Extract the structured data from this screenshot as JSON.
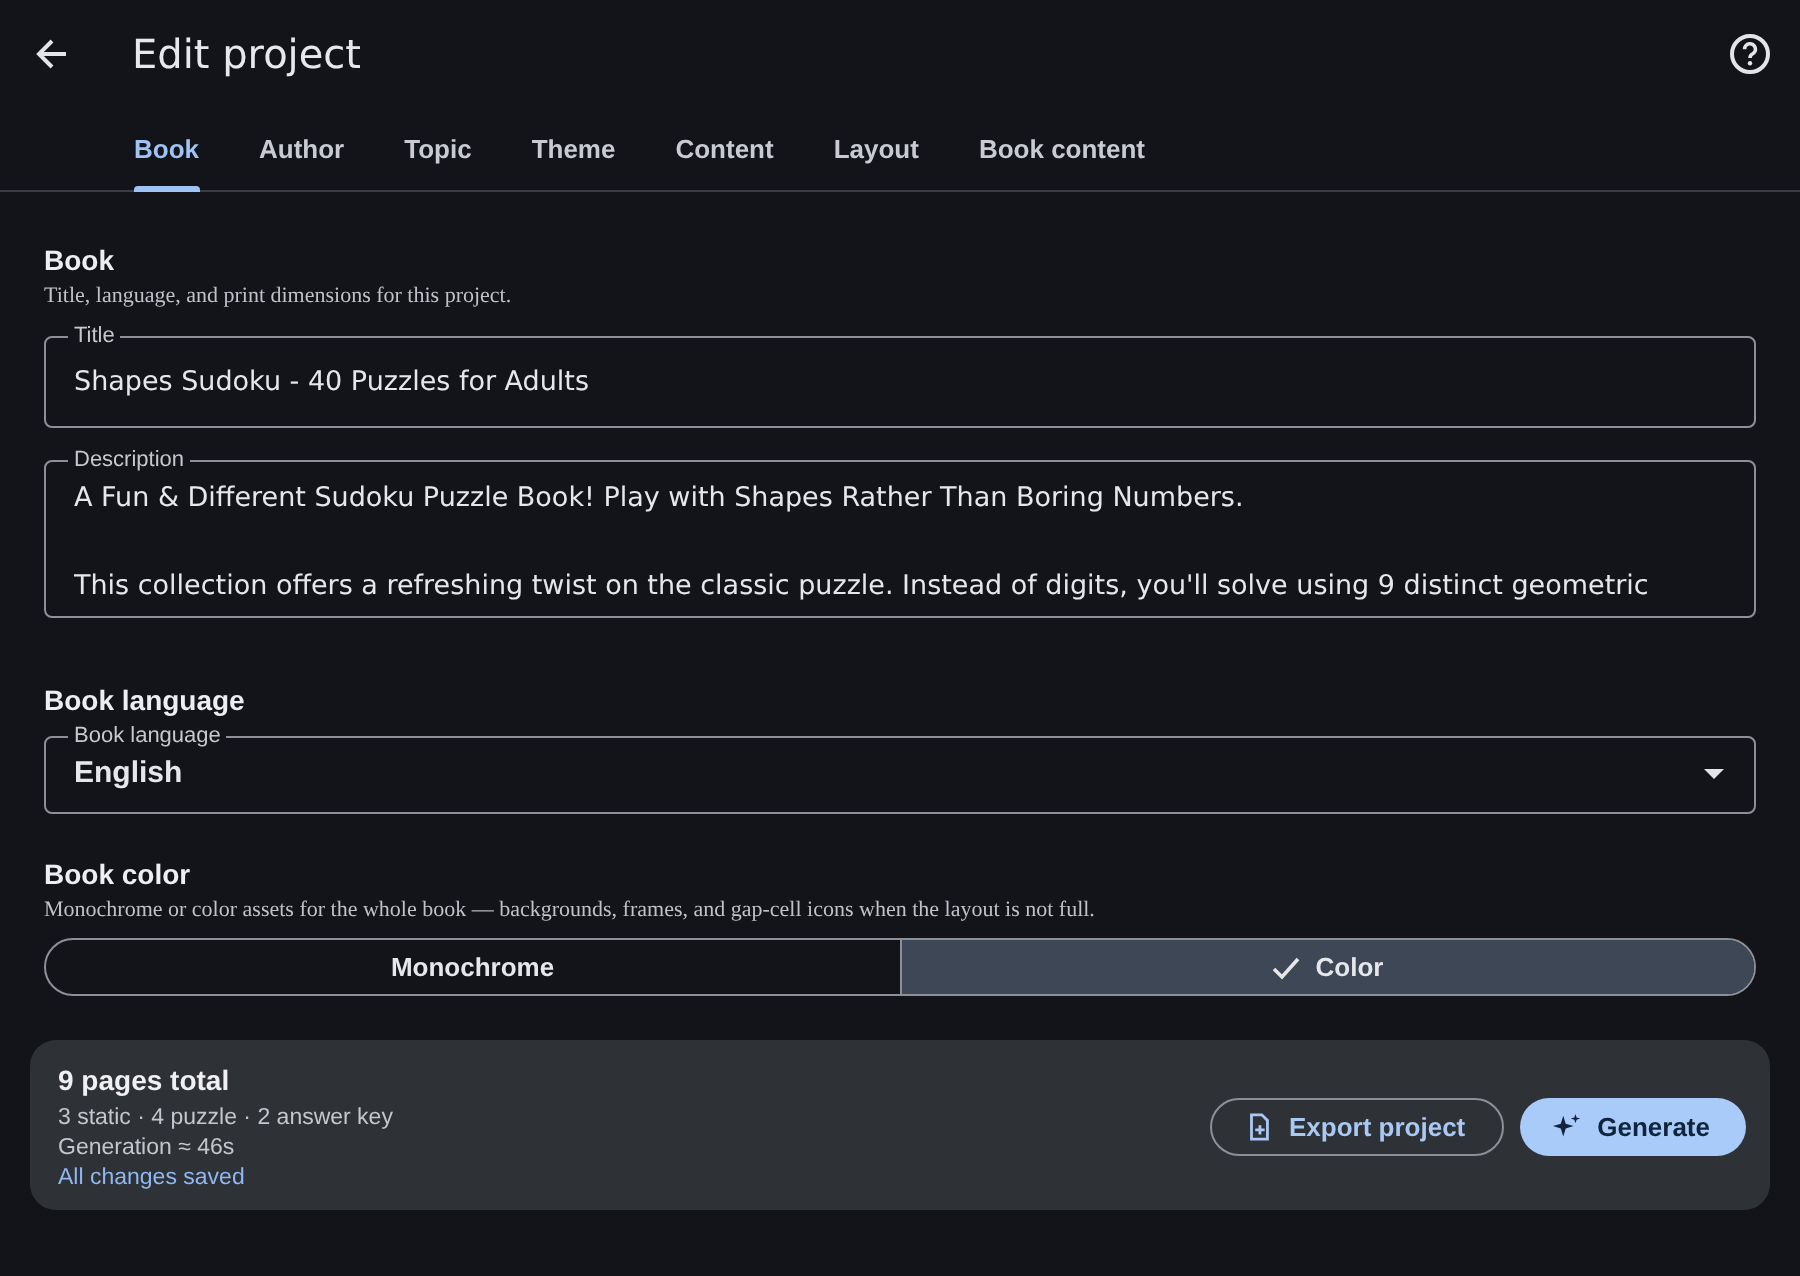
{
  "header": {
    "title": "Edit project"
  },
  "tabs": [
    {
      "label": "Book",
      "selected": true
    },
    {
      "label": "Author",
      "selected": false
    },
    {
      "label": "Topic",
      "selected": false
    },
    {
      "label": "Theme",
      "selected": false
    },
    {
      "label": "Content",
      "selected": false
    },
    {
      "label": "Layout",
      "selected": false
    },
    {
      "label": "Book content",
      "selected": false
    }
  ],
  "book": {
    "heading": "Book",
    "subtitle": "Title, language, and print dimensions for this project.",
    "title_field": {
      "label": "Title",
      "value": "Shapes Sudoku - 40 Puzzles for Adults"
    },
    "description_field": {
      "label": "Description",
      "value": "A Fun & Different Sudoku Puzzle Book! Play with Shapes Rather Than Boring Numbers.\n\nThis collection offers a refreshing twist on the classic puzzle. Instead of digits, you'll solve using 9 distinct geometric"
    }
  },
  "language": {
    "heading": "Book language",
    "field": {
      "label": "Book language",
      "value": "English"
    }
  },
  "color": {
    "heading": "Book color",
    "subtitle": "Monochrome or color assets for the whole book — backgrounds, frames, and gap-cell icons when the layout is not full.",
    "options": [
      {
        "label": "Monochrome",
        "selected": false
      },
      {
        "label": "Color",
        "selected": true
      }
    ]
  },
  "summary": {
    "total": "9 pages total",
    "breakdown": "3 static · 4 puzzle · 2 answer key",
    "generation": "Generation ≈ 46s",
    "status": "All changes saved",
    "buttons": [
      {
        "kind": "outlined",
        "label": "Export project"
      },
      {
        "kind": "filled",
        "label": "Generate"
      }
    ]
  }
}
